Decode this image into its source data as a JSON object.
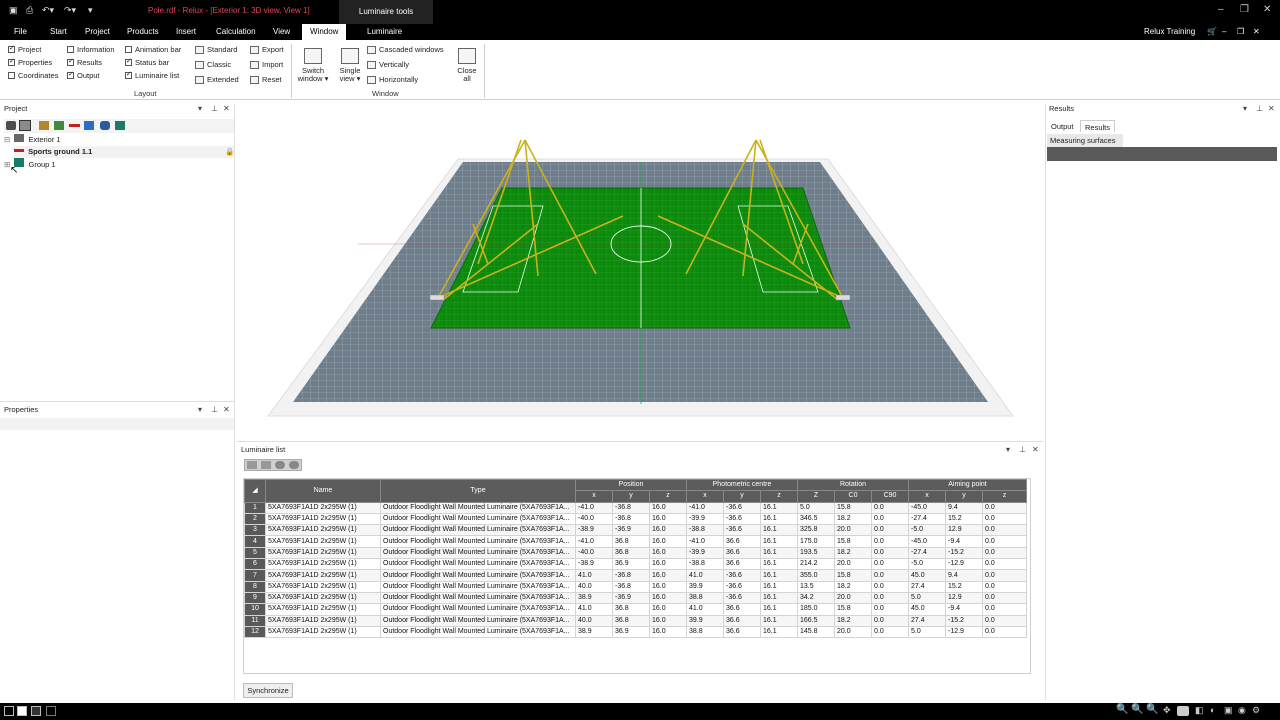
{
  "titlebar": {
    "document_title": "Pole.rdf - Relux - [Exterior 1: 3D view, View 1]",
    "context_tab": "Luminaire tools",
    "controls": {
      "minimize": "–",
      "restore": "❐",
      "close": "✕"
    }
  },
  "menu": {
    "tabs": [
      "File",
      "Start",
      "Project",
      "Products",
      "Insert",
      "Calculation",
      "View",
      "Window",
      "Luminaire"
    ],
    "active_tab": "Window",
    "user": "Relux Training",
    "inner_controls": {
      "minimize": "–",
      "restore": "❐",
      "close": "✕"
    }
  },
  "ribbon": {
    "layout_checks": [
      {
        "label": "Project",
        "checked": true
      },
      {
        "label": "Properties",
        "checked": true
      },
      {
        "label": "Coordinates",
        "checked": false
      },
      {
        "label": "Information",
        "checked": false
      },
      {
        "label": "Results",
        "checked": true
      },
      {
        "label": "Output",
        "checked": true
      },
      {
        "label": "Animation bar",
        "checked": false
      },
      {
        "label": "Status bar",
        "checked": true
      },
      {
        "label": "Luminaire list",
        "checked": true
      }
    ],
    "layout_modes": [
      "Standard",
      "Classic",
      "Extended"
    ],
    "layout_actions": [
      "Export",
      "Import",
      "Reset"
    ],
    "layout_group_label": "Layout",
    "window_big": [
      {
        "label1": "Switch",
        "label2": "window ▾"
      },
      {
        "label1": "Single",
        "label2": "view ▾"
      }
    ],
    "window_arrange": [
      "Cascaded windows",
      "Vertically",
      "Horizontally"
    ],
    "close_all": {
      "label1": "Close",
      "label2": "all"
    },
    "window_group_label": "Window"
  },
  "project_panel": {
    "title": "Project",
    "tree": [
      {
        "label": "Exterior 1",
        "bold": false
      },
      {
        "label": "Sports ground 1.1",
        "bold": true
      },
      {
        "label": "Group  1",
        "bold": false
      }
    ]
  },
  "properties_panel": {
    "title": "Properties"
  },
  "results_panel": {
    "title": "Results",
    "tabs": [
      "Output",
      "Results"
    ],
    "active_tab": "Results",
    "list_header": "Measuring surfaces"
  },
  "luminaire_list": {
    "title": "Luminaire list",
    "group_headers": [
      "Position",
      "Photometric centre",
      "Rotation",
      "Aiming point"
    ],
    "columns": [
      "Name",
      "Type",
      "x",
      "y",
      "z",
      "x",
      "y",
      "z",
      "Z",
      "C0",
      "C90",
      "x",
      "y",
      "z"
    ],
    "rows": [
      [
        "1",
        "5XA7693F1A1D 2x295W (1)",
        "Outdoor Floodlight Wall Mounted Luminaire (5XA7693F1A...",
        "-41.0",
        "-36.8",
        "16.0",
        "-41.0",
        "-36.6",
        "16.1",
        "5.0",
        "15.8",
        "0.0",
        "-45.0",
        "9.4",
        "0.0"
      ],
      [
        "2",
        "5XA7693F1A1D 2x295W (1)",
        "Outdoor Floodlight Wall Mounted Luminaire (5XA7693F1A...",
        "-40.0",
        "-36.8",
        "16.0",
        "-39.9",
        "-36.6",
        "16.1",
        "346.5",
        "18.2",
        "0.0",
        "-27.4",
        "15.2",
        "0.0"
      ],
      [
        "3",
        "5XA7693F1A1D 2x295W (1)",
        "Outdoor Floodlight Wall Mounted Luminaire (5XA7693F1A...",
        "-38.9",
        "-36.9",
        "16.0",
        "-38.8",
        "-36.6",
        "16.1",
        "325.8",
        "20.0",
        "0.0",
        "-5.0",
        "12.9",
        "0.0"
      ],
      [
        "4",
        "5XA7693F1A1D 2x295W (1)",
        "Outdoor Floodlight Wall Mounted Luminaire (5XA7693F1A...",
        "-41.0",
        "36.8",
        "16.0",
        "-41.0",
        "36.6",
        "16.1",
        "175.0",
        "15.8",
        "0.0",
        "-45.0",
        "-9.4",
        "0.0"
      ],
      [
        "5",
        "5XA7693F1A1D 2x295W (1)",
        "Outdoor Floodlight Wall Mounted Luminaire (5XA7693F1A...",
        "-40.0",
        "36.8",
        "16.0",
        "-39.9",
        "36.6",
        "16.1",
        "193.5",
        "18.2",
        "0.0",
        "-27.4",
        "-15.2",
        "0.0"
      ],
      [
        "6",
        "5XA7693F1A1D 2x295W (1)",
        "Outdoor Floodlight Wall Mounted Luminaire (5XA7693F1A...",
        "-38.9",
        "36.9",
        "16.0",
        "-38.8",
        "36.6",
        "16.1",
        "214.2",
        "20.0",
        "0.0",
        "-5.0",
        "-12.9",
        "0.0"
      ],
      [
        "7",
        "5XA7693F1A1D 2x295W (1)",
        "Outdoor Floodlight Wall Mounted Luminaire (5XA7693F1A...",
        "41.0",
        "-36.8",
        "16.0",
        "41.0",
        "-36.6",
        "16.1",
        "355.0",
        "15.8",
        "0.0",
        "45.0",
        "9.4",
        "0.0"
      ],
      [
        "8",
        "5XA7693F1A1D 2x295W (1)",
        "Outdoor Floodlight Wall Mounted Luminaire (5XA7693F1A...",
        "40.0",
        "-36.8",
        "16.0",
        "39.9",
        "-36.6",
        "16.1",
        "13.5",
        "18.2",
        "0.0",
        "27.4",
        "15.2",
        "0.0"
      ],
      [
        "9",
        "5XA7693F1A1D 2x295W (1)",
        "Outdoor Floodlight Wall Mounted Luminaire (5XA7693F1A...",
        "38.9",
        "-36.9",
        "16.0",
        "38.8",
        "-36.6",
        "16.1",
        "34.2",
        "20.0",
        "0.0",
        "5.0",
        "12.9",
        "0.0"
      ],
      [
        "10",
        "5XA7693F1A1D 2x295W (1)",
        "Outdoor Floodlight Wall Mounted Luminaire (5XA7693F1A...",
        "41.0",
        "36.8",
        "16.0",
        "41.0",
        "36.6",
        "16.1",
        "185.0",
        "15.8",
        "0.0",
        "45.0",
        "-9.4",
        "0.0"
      ],
      [
        "11",
        "5XA7693F1A1D 2x295W (1)",
        "Outdoor Floodlight Wall Mounted Luminaire (5XA7693F1A...",
        "40.0",
        "36.8",
        "16.0",
        "39.9",
        "36.6",
        "16.1",
        "166.5",
        "18.2",
        "0.0",
        "27.4",
        "-15.2",
        "0.0"
      ],
      [
        "12",
        "5XA7693F1A1D 2x295W (1)",
        "Outdoor Floodlight Wall Mounted Luminaire (5XA7693F1A...",
        "38.9",
        "36.9",
        "16.0",
        "38.8",
        "36.6",
        "16.1",
        "145.8",
        "20.0",
        "0.0",
        "5.0",
        "-12.9",
        "0.0"
      ]
    ],
    "synchronize_label": "Synchronize"
  },
  "panel_controls": {
    "dropdown": "▾",
    "pin": "⊥",
    "close": "✕"
  },
  "colors": {
    "field_green": "#0b8a0b",
    "grid_gray": "#6f7f8c",
    "pole_yellow": "#c9b21a",
    "titlebar": "#000000",
    "title_text": "#e2465a"
  }
}
